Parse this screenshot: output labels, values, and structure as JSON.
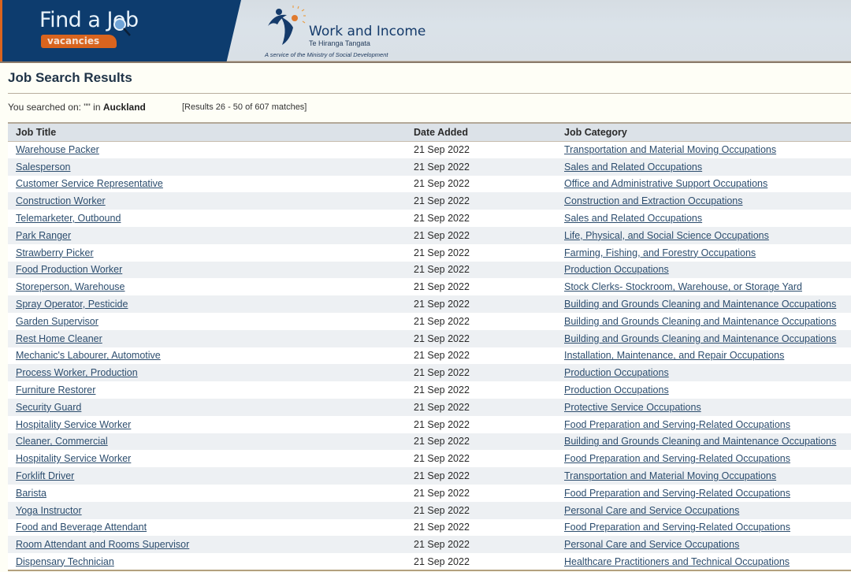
{
  "banner": {
    "find_a_job": "Find a Job",
    "vacancies": "vacancies",
    "org_name": "Work and Income",
    "org_maori": "Te Hiranga Tangata",
    "org_tagline": "A service of the Ministry of Social Development",
    "colors": {
      "navy": "#0d3c6e",
      "orange": "#d9641e"
    }
  },
  "page": {
    "title": "Job Search Results",
    "search_prefix": "You searched on: \"\" in",
    "search_location": "Auckland",
    "results_summary": "[Results 26 - 50 of 607 matches]"
  },
  "table": {
    "headers": [
      "Job Title",
      "Date Added",
      "Job Category"
    ],
    "rows": [
      {
        "title": "Warehouse Packer",
        "date": "21 Sep 2022",
        "category": "Transportation and Material Moving Occupations"
      },
      {
        "title": "Salesperson",
        "date": "21 Sep 2022",
        "category": "Sales and Related Occupations"
      },
      {
        "title": "Customer Service Representative",
        "date": "21 Sep 2022",
        "category": "Office and Administrative Support Occupations"
      },
      {
        "title": "Construction Worker",
        "date": "21 Sep 2022",
        "category": "Construction and Extraction Occupations"
      },
      {
        "title": "Telemarketer, Outbound",
        "date": "21 Sep 2022",
        "category": "Sales and Related Occupations"
      },
      {
        "title": "Park Ranger",
        "date": "21 Sep 2022",
        "category": "Life, Physical, and Social Science Occupations"
      },
      {
        "title": "Strawberry Picker",
        "date": "21 Sep 2022",
        "category": "Farming, Fishing, and Forestry Occupations"
      },
      {
        "title": "Food Production Worker",
        "date": "21 Sep 2022",
        "category": "Production Occupations"
      },
      {
        "title": "Storeperson, Warehouse",
        "date": "21 Sep 2022",
        "category": "Stock Clerks- Stockroom, Warehouse, or Storage Yard"
      },
      {
        "title": "Spray Operator, Pesticide",
        "date": "21 Sep 2022",
        "category": "Building and Grounds Cleaning and Maintenance Occupations"
      },
      {
        "title": "Garden Supervisor",
        "date": "21 Sep 2022",
        "category": "Building and Grounds Cleaning and Maintenance Occupations"
      },
      {
        "title": "Rest Home Cleaner",
        "date": "21 Sep 2022",
        "category": "Building and Grounds Cleaning and Maintenance Occupations"
      },
      {
        "title": "Mechanic's Labourer, Automotive",
        "date": "21 Sep 2022",
        "category": "Installation, Maintenance, and Repair Occupations"
      },
      {
        "title": "Process Worker, Production",
        "date": "21 Sep 2022",
        "category": "Production Occupations"
      },
      {
        "title": "Furniture Restorer",
        "date": "21 Sep 2022",
        "category": "Production Occupations"
      },
      {
        "title": "Security Guard",
        "date": "21 Sep 2022",
        "category": "Protective Service Occupations"
      },
      {
        "title": "Hospitality Service Worker",
        "date": "21 Sep 2022",
        "category": "Food Preparation and Serving-Related Occupations"
      },
      {
        "title": "Cleaner, Commercial",
        "date": "21 Sep 2022",
        "category": "Building and Grounds Cleaning and Maintenance Occupations"
      },
      {
        "title": "Hospitality Service Worker",
        "date": "21 Sep 2022",
        "category": "Food Preparation and Serving-Related Occupations"
      },
      {
        "title": "Forklift Driver",
        "date": "21 Sep 2022",
        "category": "Transportation and Material Moving Occupations"
      },
      {
        "title": "Barista",
        "date": "21 Sep 2022",
        "category": "Food Preparation and Serving-Related Occupations"
      },
      {
        "title": "Yoga Instructor",
        "date": "21 Sep 2022",
        "category": "Personal Care and Service Occupations"
      },
      {
        "title": "Food and Beverage Attendant",
        "date": "21 Sep 2022",
        "category": "Food Preparation and Serving-Related Occupations"
      },
      {
        "title": "Room Attendant and Rooms Supervisor",
        "date": "21 Sep 2022",
        "category": "Personal Care and Service Occupations"
      },
      {
        "title": "Dispensary Technician",
        "date": "21 Sep 2022",
        "category": "Healthcare Practitioners and Technical Occupations"
      }
    ]
  }
}
